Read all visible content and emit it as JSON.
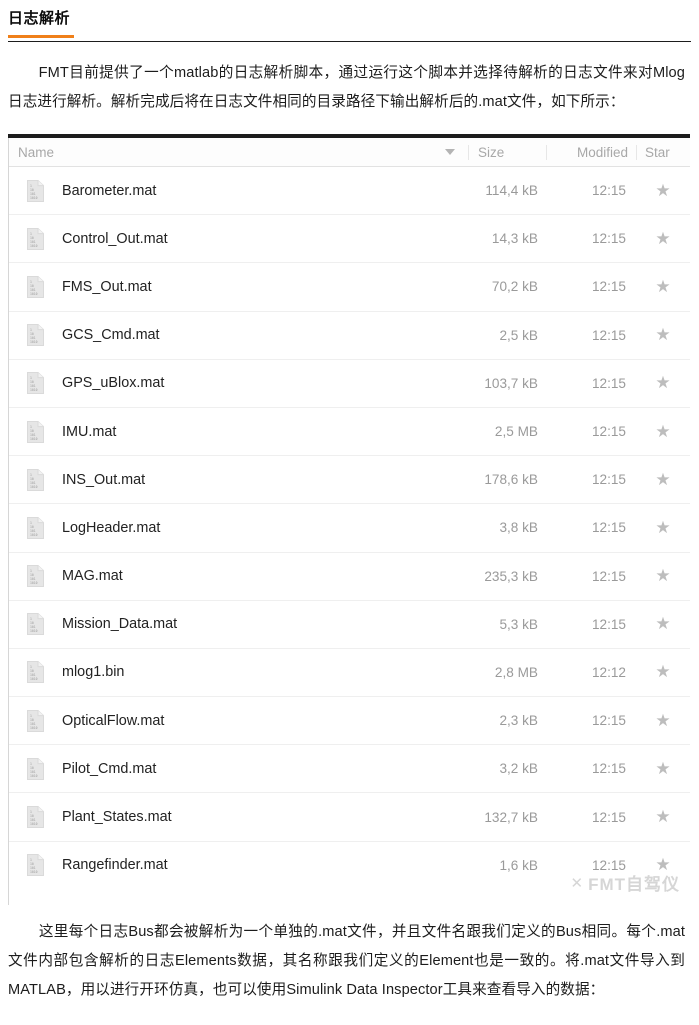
{
  "article": {
    "title": "日志解析",
    "accent_color": "#f08019",
    "paragraphs": {
      "lead": "FMT目前提供了一个matlab的日志解析脚本，通过运行这个脚本并选择待解析的日志文件来对Mlog日志进行解析。解析完成后将在日志文件相同的目录路径下输出解析后的.mat文件，如下所示：",
      "tail": "这里每个日志Bus都会被解析为一个单独的.mat文件，并且文件名跟我们定义的Bus相同。每个.mat文件内部包含解析的日志Elements数据，其名称跟我们定义的Element也是一致的。将.mat文件导入到MATLAB，用以进行开环仿真，也可以使用Simulink Data Inspector工具来查看导入的数据："
    }
  },
  "file_browser": {
    "columns": {
      "name": "Name",
      "size": "Size",
      "modified": "Modified",
      "star": "Star"
    },
    "sort_icon": "chevron-down-icon",
    "star_icon": "star-icon",
    "file_icon": "binary-file-icon",
    "rows": [
      {
        "name": "Barometer.mat",
        "size": "114,4 kB",
        "modified": "12:15",
        "star": "★"
      },
      {
        "name": "Control_Out.mat",
        "size": "14,3 kB",
        "modified": "12:15",
        "star": "★"
      },
      {
        "name": "FMS_Out.mat",
        "size": "70,2 kB",
        "modified": "12:15",
        "star": "★"
      },
      {
        "name": "GCS_Cmd.mat",
        "size": "2,5 kB",
        "modified": "12:15",
        "star": "★"
      },
      {
        "name": "GPS_uBlox.mat",
        "size": "103,7 kB",
        "modified": "12:15",
        "star": "★"
      },
      {
        "name": "IMU.mat",
        "size": "2,5 MB",
        "modified": "12:15",
        "star": "★"
      },
      {
        "name": "INS_Out.mat",
        "size": "178,6 kB",
        "modified": "12:15",
        "star": "★"
      },
      {
        "name": "LogHeader.mat",
        "size": "3,8 kB",
        "modified": "12:15",
        "star": "★"
      },
      {
        "name": "MAG.mat",
        "size": "235,3 kB",
        "modified": "12:15",
        "star": "★"
      },
      {
        "name": "Mission_Data.mat",
        "size": "5,3 kB",
        "modified": "12:15",
        "star": "★"
      },
      {
        "name": "mlog1.bin",
        "size": "2,8 MB",
        "modified": "12:12",
        "star": "★"
      },
      {
        "name": "OpticalFlow.mat",
        "size": "2,3 kB",
        "modified": "12:15",
        "star": "★"
      },
      {
        "name": "Pilot_Cmd.mat",
        "size": "3,2 kB",
        "modified": "12:15",
        "star": "★"
      },
      {
        "name": "Plant_States.mat",
        "size": "132,7 kB",
        "modified": "12:15",
        "star": "★"
      },
      {
        "name": "Rangefinder.mat",
        "size": "1,6 kB",
        "modified": "12:15",
        "star": "★"
      }
    ]
  },
  "watermark": {
    "mark": "✕",
    "text": "FMT自驾仪"
  }
}
